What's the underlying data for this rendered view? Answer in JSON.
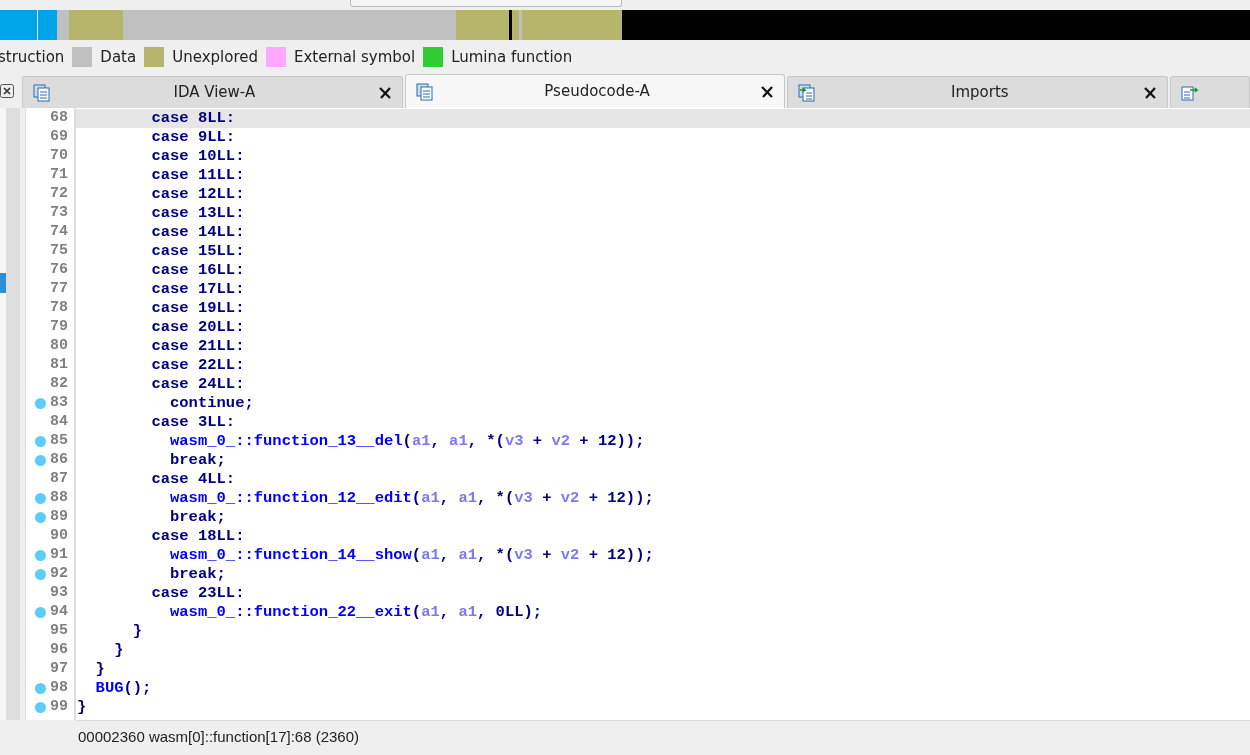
{
  "legend": [
    {
      "label": "struction"
    },
    {
      "label": "Data",
      "color": "#c0c0c0"
    },
    {
      "label": "Unexplored",
      "color": "#b5b56b"
    },
    {
      "label": "External symbol",
      "color": "#ffa8ff"
    },
    {
      "label": "Lumina function",
      "color": "#32cd32"
    }
  ],
  "tabs": [
    {
      "label": "IDA View-A",
      "selected": false
    },
    {
      "label": "Pseudocode-A",
      "selected": true
    },
    {
      "label": "Imports",
      "selected": false
    },
    {
      "selected": false
    }
  ],
  "code": {
    "lines": [
      {
        "number": "68",
        "dot": false,
        "highlighted": true,
        "tokens": [
          {
            "kind": "plain",
            "t": "        case 8LL:"
          }
        ]
      },
      {
        "number": "69",
        "dot": false,
        "highlighted": false,
        "tokens": [
          {
            "kind": "plain",
            "t": "        case 9LL:"
          }
        ]
      },
      {
        "number": "70",
        "dot": false,
        "highlighted": false,
        "tokens": [
          {
            "kind": "plain",
            "t": "        case 10LL:"
          }
        ]
      },
      {
        "number": "71",
        "dot": false,
        "highlighted": false,
        "tokens": [
          {
            "kind": "plain",
            "t": "        case 11LL:"
          }
        ]
      },
      {
        "number": "72",
        "dot": false,
        "highlighted": false,
        "tokens": [
          {
            "kind": "plain",
            "t": "        case 12LL:"
          }
        ]
      },
      {
        "number": "73",
        "dot": false,
        "highlighted": false,
        "tokens": [
          {
            "kind": "plain",
            "t": "        case 13LL:"
          }
        ]
      },
      {
        "number": "74",
        "dot": false,
        "highlighted": false,
        "tokens": [
          {
            "kind": "plain",
            "t": "        case 14LL:"
          }
        ]
      },
      {
        "number": "75",
        "dot": false,
        "highlighted": false,
        "tokens": [
          {
            "kind": "plain",
            "t": "        case 15LL:"
          }
        ]
      },
      {
        "number": "76",
        "dot": false,
        "highlighted": false,
        "tokens": [
          {
            "kind": "plain",
            "t": "        case 16LL:"
          }
        ]
      },
      {
        "number": "77",
        "dot": false,
        "highlighted": false,
        "tokens": [
          {
            "kind": "plain",
            "t": "        case 17LL:"
          }
        ]
      },
      {
        "number": "78",
        "dot": false,
        "highlighted": false,
        "tokens": [
          {
            "kind": "plain",
            "t": "        case 19LL:"
          }
        ]
      },
      {
        "number": "79",
        "dot": false,
        "highlighted": false,
        "tokens": [
          {
            "kind": "plain",
            "t": "        case 20LL:"
          }
        ]
      },
      {
        "number": "80",
        "dot": false,
        "highlighted": false,
        "tokens": [
          {
            "kind": "plain",
            "t": "        case 21LL:"
          }
        ]
      },
      {
        "number": "81",
        "dot": false,
        "highlighted": false,
        "tokens": [
          {
            "kind": "plain",
            "t": "        case 22LL:"
          }
        ]
      },
      {
        "number": "82",
        "dot": false,
        "highlighted": false,
        "tokens": [
          {
            "kind": "plain",
            "t": "        case 24LL:"
          }
        ]
      },
      {
        "number": "83",
        "dot": true,
        "highlighted": false,
        "tokens": [
          {
            "kind": "plain",
            "t": "          continue;"
          }
        ]
      },
      {
        "number": "84",
        "dot": false,
        "highlighted": false,
        "tokens": [
          {
            "kind": "plain",
            "t": "        case 3LL:"
          }
        ]
      },
      {
        "number": "85",
        "dot": true,
        "highlighted": false,
        "tokens": [
          {
            "kind": "func",
            "t": "          wasm_0_::function_13__del"
          },
          {
            "kind": "plain",
            "t": "("
          },
          {
            "kind": "var",
            "t": "a1"
          },
          {
            "kind": "plain",
            "t": ", "
          },
          {
            "kind": "var",
            "t": "a1"
          },
          {
            "kind": "plain",
            "t": ", *("
          },
          {
            "kind": "var",
            "t": "v3"
          },
          {
            "kind": "plain",
            "t": " + "
          },
          {
            "kind": "var",
            "t": "v2"
          },
          {
            "kind": "plain",
            "t": " + 12));"
          }
        ]
      },
      {
        "number": "86",
        "dot": true,
        "highlighted": false,
        "tokens": [
          {
            "kind": "plain",
            "t": "          break;"
          }
        ]
      },
      {
        "number": "87",
        "dot": false,
        "highlighted": false,
        "tokens": [
          {
            "kind": "plain",
            "t": "        case 4LL:"
          }
        ]
      },
      {
        "number": "88",
        "dot": true,
        "highlighted": false,
        "tokens": [
          {
            "kind": "func",
            "t": "          wasm_0_::function_12__edit"
          },
          {
            "kind": "plain",
            "t": "("
          },
          {
            "kind": "var",
            "t": "a1"
          },
          {
            "kind": "plain",
            "t": ", "
          },
          {
            "kind": "var",
            "t": "a1"
          },
          {
            "kind": "plain",
            "t": ", *("
          },
          {
            "kind": "var",
            "t": "v3"
          },
          {
            "kind": "plain",
            "t": " + "
          },
          {
            "kind": "var",
            "t": "v2"
          },
          {
            "kind": "plain",
            "t": " + 12));"
          }
        ]
      },
      {
        "number": "89",
        "dot": true,
        "highlighted": false,
        "tokens": [
          {
            "kind": "plain",
            "t": "          break;"
          }
        ]
      },
      {
        "number": "90",
        "dot": false,
        "highlighted": false,
        "tokens": [
          {
            "kind": "plain",
            "t": "        case 18LL:"
          }
        ]
      },
      {
        "number": "91",
        "dot": true,
        "highlighted": false,
        "tokens": [
          {
            "kind": "func",
            "t": "          wasm_0_::function_14__show"
          },
          {
            "kind": "plain",
            "t": "("
          },
          {
            "kind": "var",
            "t": "a1"
          },
          {
            "kind": "plain",
            "t": ", "
          },
          {
            "kind": "var",
            "t": "a1"
          },
          {
            "kind": "plain",
            "t": ", *("
          },
          {
            "kind": "var",
            "t": "v3"
          },
          {
            "kind": "plain",
            "t": " + "
          },
          {
            "kind": "var",
            "t": "v2"
          },
          {
            "kind": "plain",
            "t": " + 12));"
          }
        ]
      },
      {
        "number": "92",
        "dot": true,
        "highlighted": false,
        "tokens": [
          {
            "kind": "plain",
            "t": "          break;"
          }
        ]
      },
      {
        "number": "93",
        "dot": false,
        "highlighted": false,
        "tokens": [
          {
            "kind": "plain",
            "t": "        case 23LL:"
          }
        ]
      },
      {
        "number": "94",
        "dot": true,
        "highlighted": false,
        "tokens": [
          {
            "kind": "func",
            "t": "          wasm_0_::function_22__exit"
          },
          {
            "kind": "plain",
            "t": "("
          },
          {
            "kind": "var",
            "t": "a1"
          },
          {
            "kind": "plain",
            "t": ", "
          },
          {
            "kind": "var",
            "t": "a1"
          },
          {
            "kind": "plain",
            "t": ", 0LL);"
          }
        ]
      },
      {
        "number": "95",
        "dot": false,
        "highlighted": false,
        "tokens": [
          {
            "kind": "plain",
            "t": "      }"
          }
        ]
      },
      {
        "number": "96",
        "dot": false,
        "highlighted": false,
        "tokens": [
          {
            "kind": "plain",
            "t": "    }"
          }
        ]
      },
      {
        "number": "97",
        "dot": false,
        "highlighted": false,
        "tokens": [
          {
            "kind": "plain",
            "t": "  }"
          }
        ]
      },
      {
        "number": "98",
        "dot": true,
        "highlighted": false,
        "tokens": [
          {
            "kind": "func",
            "t": "  BUG"
          },
          {
            "kind": "plain",
            "t": "();"
          }
        ]
      },
      {
        "number": "99",
        "dot": true,
        "highlighted": false,
        "tokens": [
          {
            "kind": "plain",
            "t": "}"
          }
        ]
      }
    ]
  },
  "status_bar": "00002360 wasm[0]::function[17]:68 (2360)"
}
